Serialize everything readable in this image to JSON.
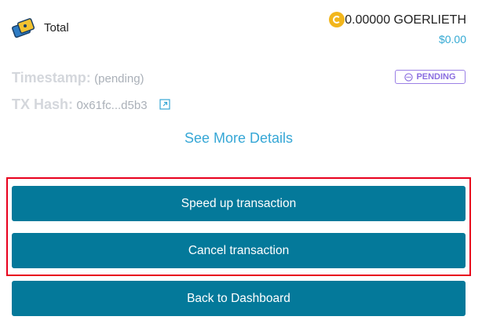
{
  "summary": {
    "total_label": "Total",
    "amount": "0.00000 GOERLIETH",
    "fiat_amount": "$0.00",
    "coin_icon": "coin-icon",
    "total_icon": "wallet-tag-icon"
  },
  "details": {
    "timestamp_label": "Timestamp:",
    "timestamp_value": "(pending)",
    "tx_hash_label": "TX Hash:",
    "tx_hash_value": "0x61fc...d5b3",
    "status_badge": "PENDING",
    "status_color": "#8a6de0",
    "see_more_label": "See More Details"
  },
  "actions": {
    "speed_up_label": "Speed up transaction",
    "cancel_label": "Cancel transaction",
    "back_label": "Back to Dashboard",
    "button_color": "#04799a",
    "highlight_color": "#e8001d"
  }
}
